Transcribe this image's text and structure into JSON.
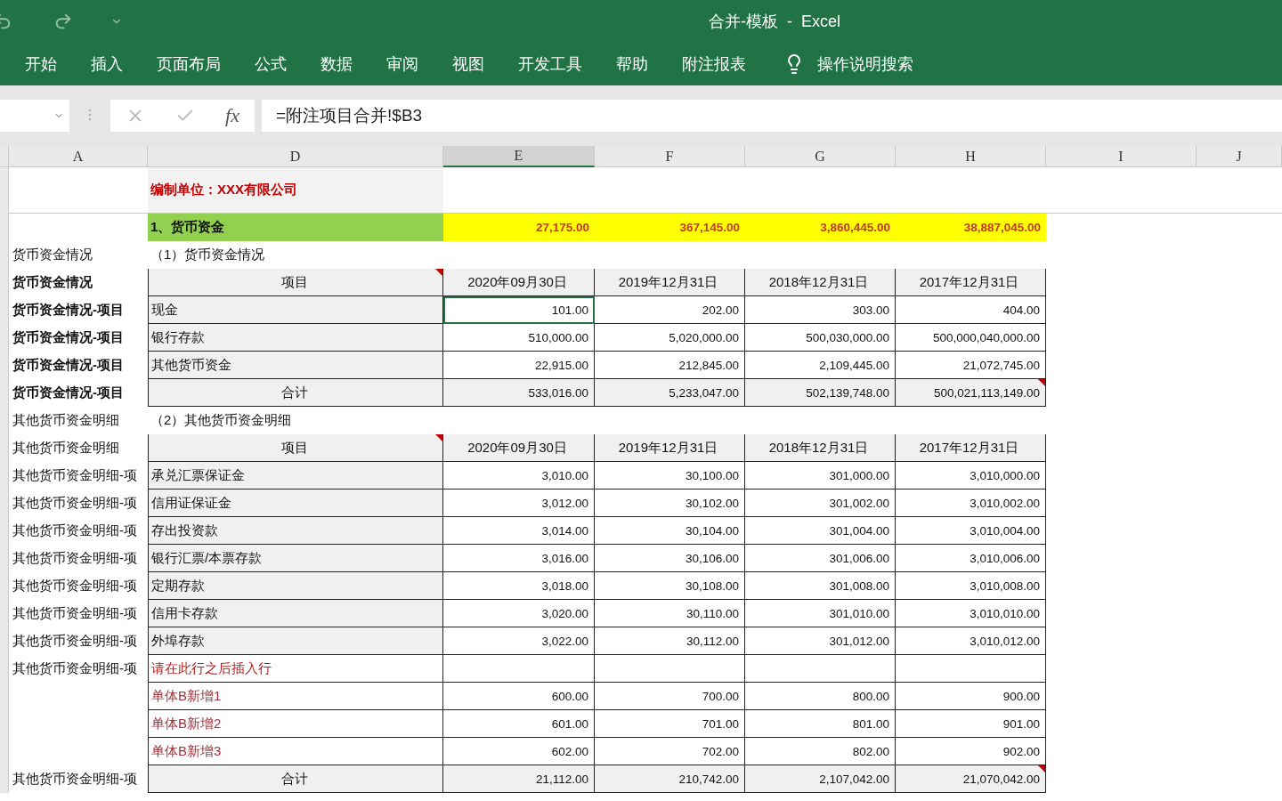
{
  "window": {
    "title": "合并-模板  -  Excel"
  },
  "ribbon_tabs": [
    {
      "label": "开始"
    },
    {
      "label": "插入"
    },
    {
      "label": "页面布局"
    },
    {
      "label": "公式"
    },
    {
      "label": "数据"
    },
    {
      "label": "审阅"
    },
    {
      "label": "视图"
    },
    {
      "label": "开发工具"
    },
    {
      "label": "帮助"
    },
    {
      "label": "附注报表"
    }
  ],
  "tell_me": {
    "placeholder": "操作说明搜索"
  },
  "formula_bar": {
    "function_label": "fx",
    "formula": "=附注项目合并!$B3"
  },
  "column_headers": [
    {
      "label": "A",
      "selected": false
    },
    {
      "label": "D",
      "selected": false
    },
    {
      "label": "E",
      "selected": true
    },
    {
      "label": "F",
      "selected": false
    },
    {
      "label": "G",
      "selected": false
    },
    {
      "label": "H",
      "selected": false
    },
    {
      "label": "I",
      "selected": false
    },
    {
      "label": "J",
      "selected": false
    }
  ],
  "rows": [
    {
      "kind": "company",
      "selected": false,
      "item": "编制单位：XXX有限公司"
    },
    {
      "kind": "section",
      "selected": false,
      "item": "1、货币资金",
      "values": [
        "27,175.00",
        "367,145.00",
        "3,860,445.00",
        "38,887,045.00"
      ]
    },
    {
      "kind": "subtitle",
      "selected": false,
      "label": {
        "text": "货币资金情况",
        "bold": false
      },
      "item": "（1）货币资金情况"
    },
    {
      "kind": "header",
      "selected": false,
      "flagged": true,
      "label": {
        "text": "货币资金情况",
        "bold": true
      },
      "item": "项目",
      "values": [
        "2020年09月30日",
        "2019年12月31日",
        "2018年12月31日",
        "2017年12月31日"
      ]
    },
    {
      "kind": "item",
      "selected": true,
      "label": {
        "text": "货币资金情况-项目",
        "bold": true
      },
      "item": "现金",
      "values": [
        "101.00",
        "202.00",
        "303.00",
        "404.00"
      ]
    },
    {
      "kind": "item",
      "selected": false,
      "label": {
        "text": "货币资金情况-项目",
        "bold": true
      },
      "item": "银行存款",
      "values": [
        "510,000.00",
        "5,020,000.00",
        "500,030,000.00",
        "500,000,040,000.00"
      ]
    },
    {
      "kind": "item",
      "selected": false,
      "label": {
        "text": "货币资金情况-项目",
        "bold": true
      },
      "item": "其他货币资金",
      "values": [
        "22,915.00",
        "212,845.00",
        "2,109,445.00",
        "21,072,745.00"
      ]
    },
    {
      "kind": "total",
      "selected": false,
      "flagged": true,
      "label": {
        "text": "货币资金情况-项目",
        "bold": true
      },
      "item": "合计",
      "values": [
        "533,016.00",
        "5,233,047.00",
        "502,139,748.00",
        "500,021,113,149.00"
      ]
    },
    {
      "kind": "subtitle",
      "selected": false,
      "label": {
        "text": "其他货币资金明细",
        "bold": false
      },
      "item": "（2）其他货币资金明细"
    },
    {
      "kind": "header",
      "selected": false,
      "flagged": true,
      "label": {
        "text": "其他货币资金明细",
        "bold": false
      },
      "item": "项目",
      "values": [
        "2020年09月30日",
        "2019年12月31日",
        "2018年12月31日",
        "2017年12月31日"
      ]
    },
    {
      "kind": "item",
      "selected": false,
      "label": {
        "text": "其他货币资金明细-项",
        "bold": false
      },
      "item": "承兑汇票保证金",
      "values": [
        "3,010.00",
        "30,100.00",
        "301,000.00",
        "3,010,000.00"
      ]
    },
    {
      "kind": "item",
      "selected": false,
      "label": {
        "text": "其他货币资金明细-项",
        "bold": false
      },
      "item": "信用证保证金",
      "values": [
        "3,012.00",
        "30,102.00",
        "301,002.00",
        "3,010,002.00"
      ]
    },
    {
      "kind": "item",
      "selected": false,
      "label": {
        "text": "其他货币资金明细-项",
        "bold": false
      },
      "item": "存出投资款",
      "values": [
        "3,014.00",
        "30,104.00",
        "301,004.00",
        "3,010,004.00"
      ]
    },
    {
      "kind": "item",
      "selected": false,
      "label": {
        "text": "其他货币资金明细-项",
        "bold": false
      },
      "item": "银行汇票/本票存款",
      "values": [
        "3,016.00",
        "30,106.00",
        "301,006.00",
        "3,010,006.00"
      ]
    },
    {
      "kind": "item",
      "selected": false,
      "label": {
        "text": "其他货币资金明细-项",
        "bold": false
      },
      "item": "定期存款",
      "values": [
        "3,018.00",
        "30,108.00",
        "301,008.00",
        "3,010,008.00"
      ]
    },
    {
      "kind": "item",
      "selected": false,
      "label": {
        "text": "其他货币资金明细-项",
        "bold": false
      },
      "item": "信用卡存款",
      "values": [
        "3,020.00",
        "30,110.00",
        "301,010.00",
        "3,010,010.00"
      ]
    },
    {
      "kind": "item",
      "selected": false,
      "label": {
        "text": "其他货币资金明细-项",
        "bold": false
      },
      "item": "外埠存款",
      "values": [
        "3,022.00",
        "30,112.00",
        "301,012.00",
        "3,010,012.00"
      ]
    },
    {
      "kind": "note",
      "selected": false,
      "label": {
        "text": "其他货币资金明细-项",
        "bold": false
      },
      "item": "请在此行之后插入行"
    },
    {
      "kind": "added",
      "selected": false,
      "item": "单体B新增1",
      "values": [
        "600.00",
        "700.00",
        "800.00",
        "900.00"
      ]
    },
    {
      "kind": "added",
      "selected": false,
      "item": "单体B新增2",
      "values": [
        "601.00",
        "701.00",
        "801.00",
        "901.00"
      ]
    },
    {
      "kind": "added",
      "selected": false,
      "item": "单体B新增3",
      "values": [
        "602.00",
        "702.00",
        "802.00",
        "902.00"
      ]
    },
    {
      "kind": "total",
      "selected": false,
      "flagged": true,
      "label": {
        "text": "其他货币资金明细-项",
        "bold": false
      },
      "item": "合计",
      "values": [
        "21,112.00",
        "210,742.00",
        "2,107,042.00",
        "21,070,042.00"
      ]
    }
  ]
}
